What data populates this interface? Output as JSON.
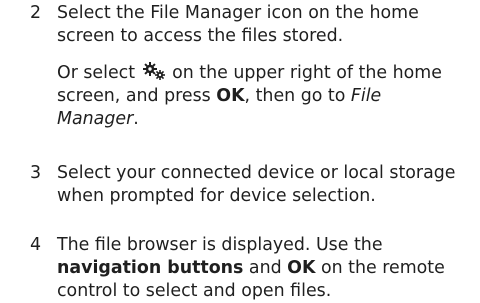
{
  "steps": [
    {
      "number": "2",
      "paragraphs": [
        {
          "text": "Select the File Manager icon on the home screen to access the files stored."
        },
        {
          "before_icon": "Or select ",
          "icon": "settings-gear-icon",
          "after_icon": " on the upper right of the home screen, and press ",
          "bold": "OK",
          "middle": ", then go to ",
          "italic": "File Manager",
          "end": "."
        }
      ]
    },
    {
      "number": "3",
      "paragraphs": [
        {
          "text": "Select your connected device or local storage when prompted for device selection."
        }
      ]
    },
    {
      "number": "4",
      "paragraphs": [
        {
          "start": "The file browser is displayed. Use the ",
          "bold1": "navigation buttons",
          "middle": " and ",
          "bold2": "OK",
          "end": " on the remote control to select and open files."
        }
      ]
    }
  ]
}
